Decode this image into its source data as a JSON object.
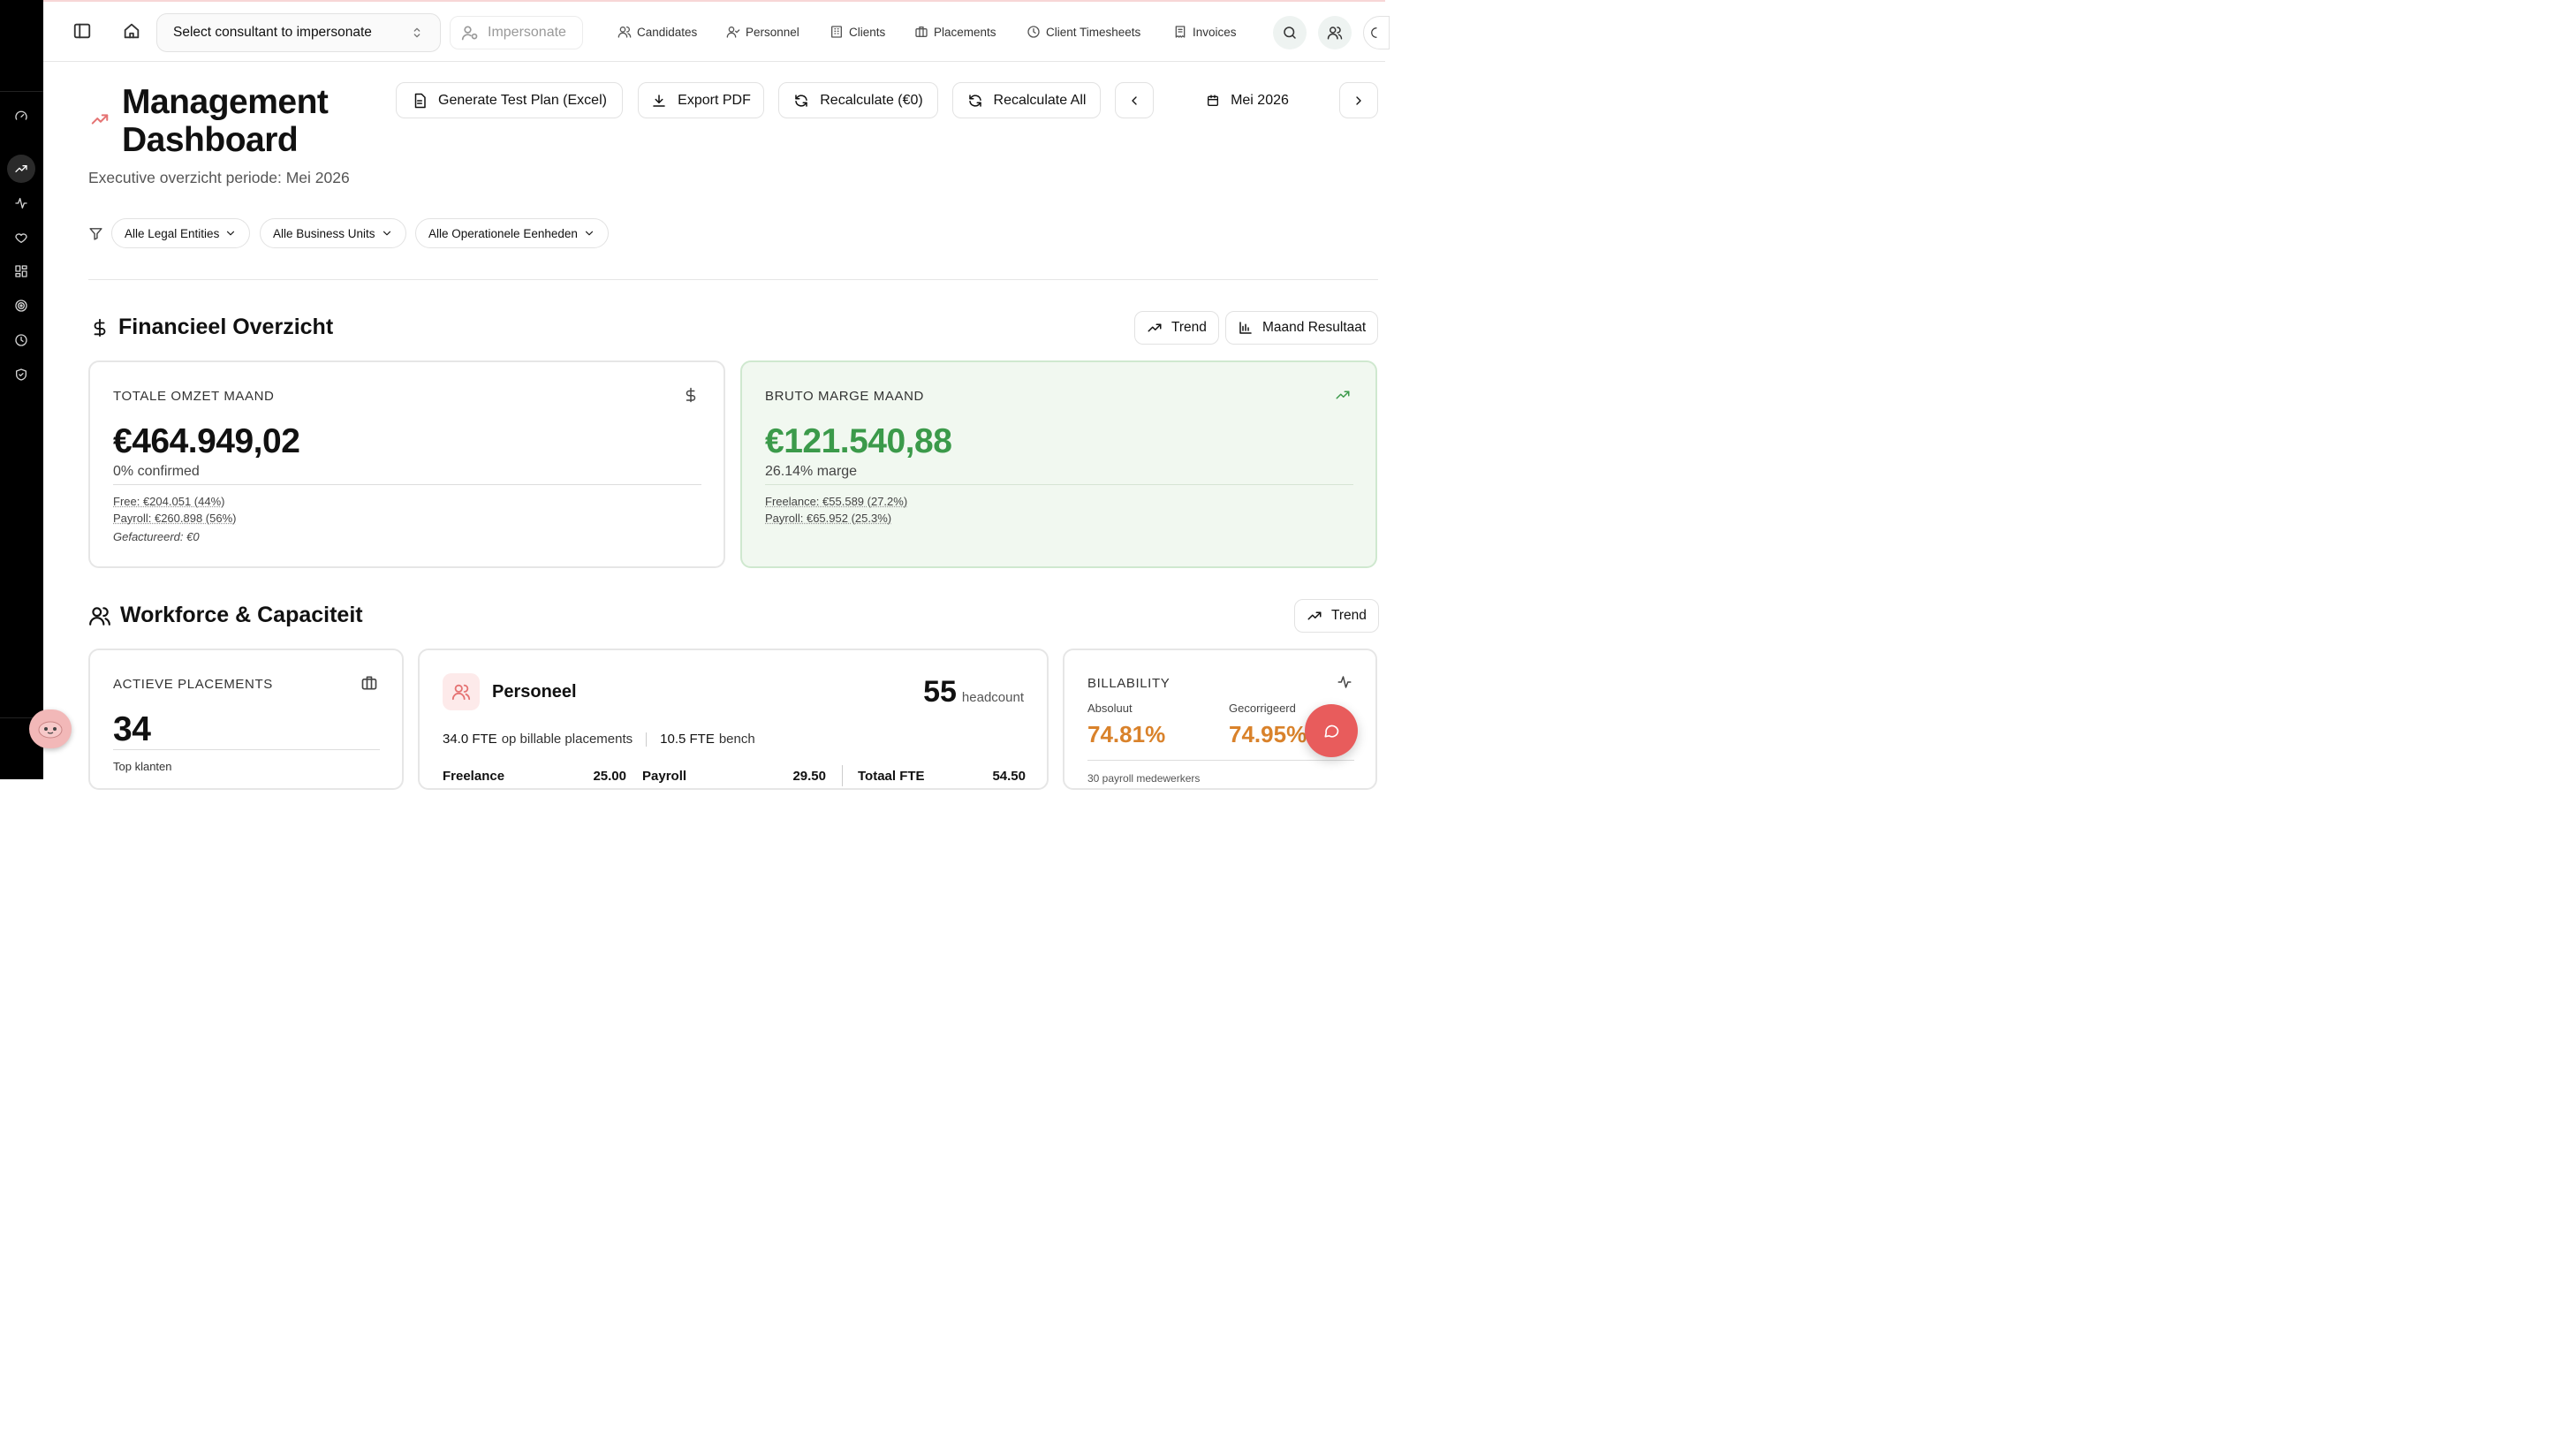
{
  "header": {
    "consultant_select": "Select consultant to impersonate",
    "impersonate_label": "Impersonate",
    "nav": [
      "Candidates",
      "Personnel",
      "Clients",
      "Placements",
      "Client Timesheets",
      "Invoices"
    ]
  },
  "page": {
    "title": "Management Dashboard",
    "subtitle": "Executive overzicht periode: Mei 2026",
    "period": "Mei 2026"
  },
  "toolbar": {
    "generate_test_plan": "Generate Test Plan (Excel)",
    "export_pdf": "Export PDF",
    "recalculate": "Recalculate (€0)",
    "recalculate_all": "Recalculate All"
  },
  "filters": [
    "Alle Legal Entities",
    "Alle Business Units",
    "Alle Operationele Eenheden"
  ],
  "financial": {
    "title": "Financieel Overzicht",
    "trend": "Trend",
    "month_result": "Maand Resultaat",
    "revenue": {
      "label": "TOTALE OMZET MAAND",
      "value": "€464.949,02",
      "confirmed": "0% confirmed",
      "free": "Free: €204.051 (44%)",
      "payroll": "Payroll: €260.898 (56%)",
      "invoiced": "Gefactureerd: €0"
    },
    "margin": {
      "label": "BRUTO MARGE MAAND",
      "value": "€121.540,88",
      "margin_pct": "26.14% marge",
      "freelance": "Freelance: €55.589 (27.2%)",
      "payroll": "Payroll: €65.952 (25.3%)"
    }
  },
  "workforce": {
    "title": "Workforce & Capaciteit",
    "trend": "Trend",
    "placements": {
      "label": "ACTIEVE PLACEMENTS",
      "value": "34",
      "top_clients": "Top klanten"
    },
    "personnel": {
      "title": "Personeel",
      "headcount": "55",
      "headcount_label": "headcount",
      "fte_billable_value": "34.0 FTE",
      "fte_billable_text": "op billable placements",
      "fte_bench_value": "10.5 FTE",
      "fte_bench_text": "bench",
      "freelance_label": "Freelance",
      "freelance_value": "25.00",
      "payroll_label": "Payroll",
      "payroll_value": "29.50",
      "total_label": "Totaal FTE",
      "total_value": "54.50"
    },
    "billability": {
      "label": "BILLABILITY",
      "absolute_label": "Absoluut",
      "absolute_value": "74.81%",
      "corrected_label": "Gecorrigeerd",
      "corrected_value": "74.95%",
      "payroll_employees": "30 payroll medewerkers"
    }
  },
  "colors": {
    "accent_red": "#e85c5c",
    "green": "#3b9a4a",
    "orange": "#d9822b"
  }
}
